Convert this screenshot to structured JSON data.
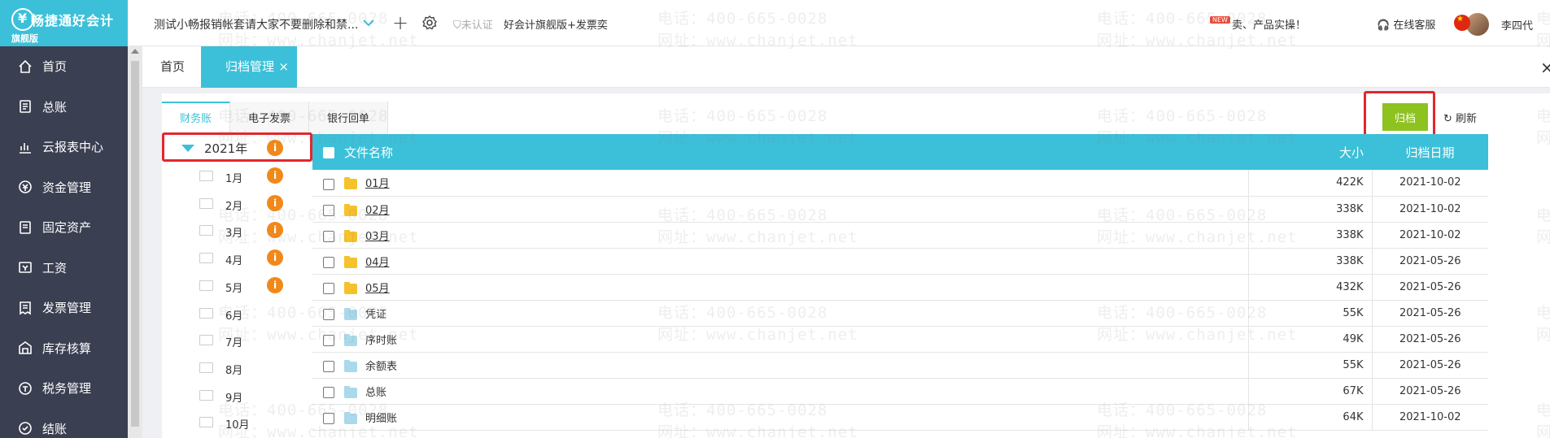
{
  "app": {
    "logo_text": "畅捷通好会计",
    "logo_sub": "旗舰版"
  },
  "sidebar": {
    "items": [
      {
        "label": "首页",
        "icon": "home-icon"
      },
      {
        "label": "总账",
        "icon": "ledger-icon"
      },
      {
        "label": "云报表中心",
        "icon": "chart-icon"
      },
      {
        "label": "资金管理",
        "icon": "money-icon"
      },
      {
        "label": "固定资产",
        "icon": "asset-icon"
      },
      {
        "label": "工资",
        "icon": "salary-icon"
      },
      {
        "label": "发票管理",
        "icon": "invoice-icon"
      },
      {
        "label": "库存核算",
        "icon": "warehouse-icon"
      },
      {
        "label": "税务管理",
        "icon": "tax-icon"
      },
      {
        "label": "结账",
        "icon": "checkout-icon"
      }
    ]
  },
  "header": {
    "account_name": "测试小畅报销帐套请大家不要删除和禁...",
    "cert_status": "未认证",
    "edition": "好会计旗舰版+发票奕",
    "new_badge": "NEW",
    "promo": "卖、产品实操！",
    "service": "在线客服",
    "username": "李四代"
  },
  "tabs": {
    "home": "首页",
    "active": "归档管理",
    "close": "×",
    "page_close": "×"
  },
  "subtabs": [
    "财务账",
    "电子发票",
    "银行回单"
  ],
  "toolbar": {
    "archive": "归档",
    "refresh": "刷新"
  },
  "tree": {
    "year": "2021年",
    "months": [
      "1月",
      "2月",
      "3月",
      "4月",
      "5月",
      "6月",
      "7月",
      "8月",
      "9月",
      "10月"
    ],
    "months_with_info": [
      0,
      1,
      2,
      3,
      4
    ]
  },
  "table": {
    "headers": {
      "name": "文件名称",
      "size": "大小",
      "date": "归档日期"
    },
    "rows": [
      {
        "name": "01月",
        "type": "folder",
        "size": "422K",
        "date": "2021-10-02"
      },
      {
        "name": "02月",
        "type": "folder",
        "size": "338K",
        "date": "2021-10-02"
      },
      {
        "name": "03月",
        "type": "folder",
        "size": "338K",
        "date": "2021-10-02"
      },
      {
        "name": "04月",
        "type": "folder",
        "size": "338K",
        "date": "2021-05-26"
      },
      {
        "name": "05月",
        "type": "folder",
        "size": "432K",
        "date": "2021-05-26"
      },
      {
        "name": "凭证",
        "type": "doc",
        "size": "55K",
        "date": "2021-05-26"
      },
      {
        "name": "序时账",
        "type": "doc",
        "size": "49K",
        "date": "2021-05-26"
      },
      {
        "name": "余额表",
        "type": "doc",
        "size": "55K",
        "date": "2021-05-26"
      },
      {
        "name": "总账",
        "type": "doc",
        "size": "67K",
        "date": "2021-05-26"
      },
      {
        "name": "明细账",
        "type": "doc",
        "size": "64K",
        "date": "2021-10-02"
      }
    ]
  },
  "watermark": {
    "phone": "电话：400-665-0028",
    "site": "网址：www.chanjet.net"
  },
  "colors": {
    "primary": "#3cc0d9",
    "sidebar": "#3a3f51",
    "archive": "#8dc21f",
    "highlight": "#e3262d",
    "info": "#f0891a"
  }
}
